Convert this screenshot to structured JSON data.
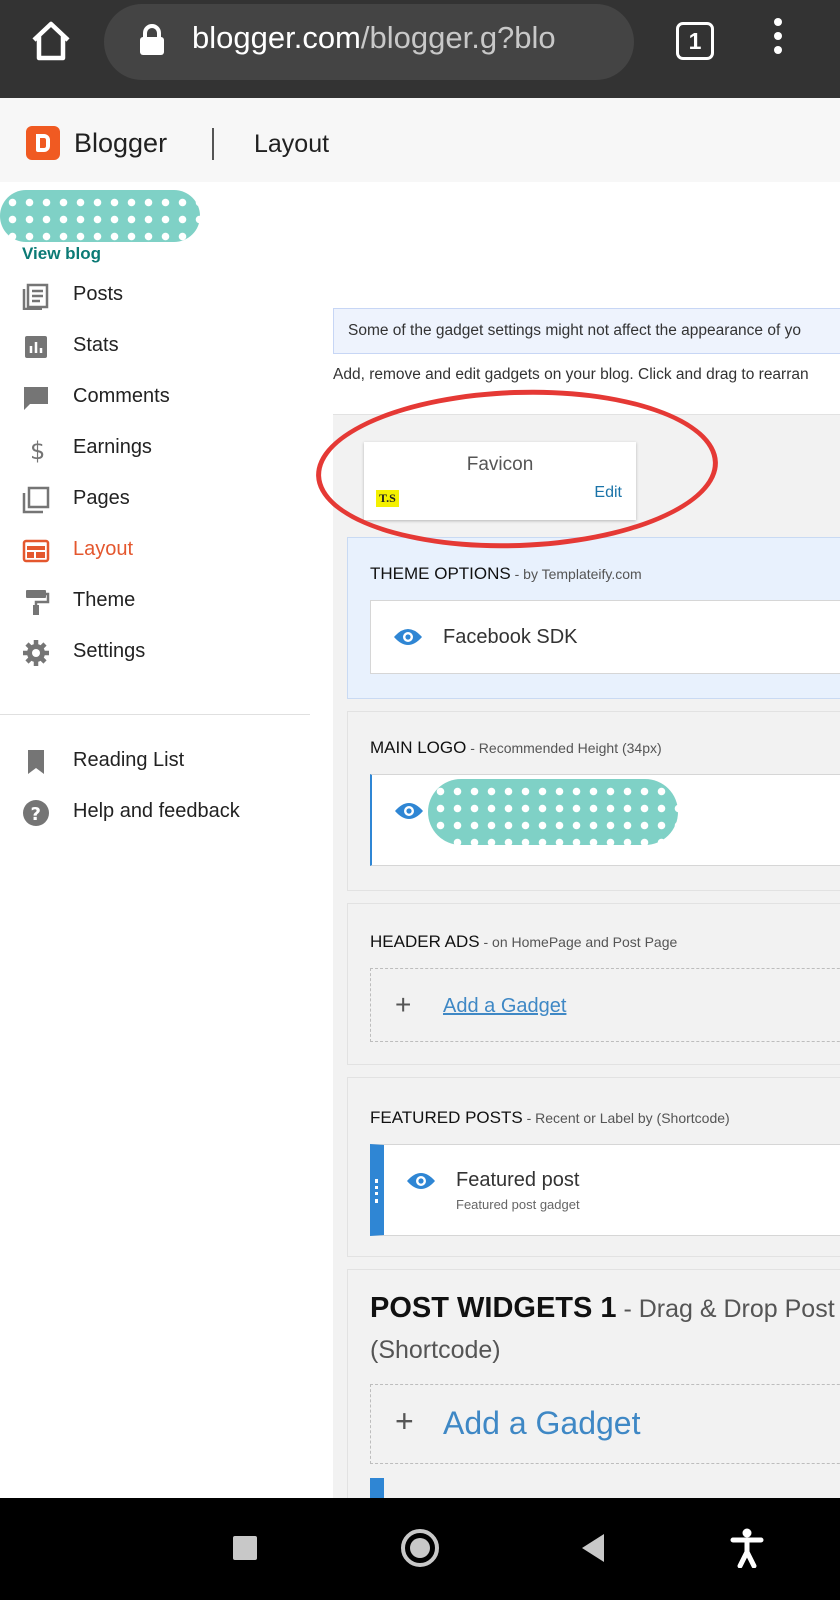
{
  "browser": {
    "url_host": "blogger.com",
    "url_rest": "/blogger.g?blo",
    "tab_count": "1"
  },
  "header": {
    "app_name": "Blogger",
    "page_title": "Layout"
  },
  "sidebar": {
    "view_blog": "View blog",
    "items": [
      {
        "label": "Posts",
        "icon": "posts-icon"
      },
      {
        "label": "Stats",
        "icon": "stats-icon"
      },
      {
        "label": "Comments",
        "icon": "comments-icon"
      },
      {
        "label": "Earnings",
        "icon": "dollar-icon"
      },
      {
        "label": "Pages",
        "icon": "pages-icon"
      },
      {
        "label": "Layout",
        "icon": "layout-icon",
        "active": true
      },
      {
        "label": "Theme",
        "icon": "paint-roller-icon"
      },
      {
        "label": "Settings",
        "icon": "gear-icon"
      }
    ],
    "secondary": [
      {
        "label": "Reading List",
        "icon": "bookmark-icon"
      },
      {
        "label": "Help and feedback",
        "icon": "help-icon"
      }
    ]
  },
  "main": {
    "notice": "Some of the gadget settings might not affect the appearance of yo",
    "help_text": "Add, remove and edit gadgets on your blog. Click and drag to rearran",
    "favicon": {
      "title": "Favicon",
      "badge": "T.S",
      "edit": "Edit"
    },
    "sections": {
      "theme_options": {
        "title": "THEME OPTIONS",
        "subtitle": " - by Templateify.com",
        "gadget": "Facebook SDK"
      },
      "main_logo": {
        "title": "MAIN LOGO",
        "subtitle": " - Recommended Height (34px)"
      },
      "header_ads": {
        "title": "HEADER ADS",
        "subtitle": " - on HomePage and Post Page",
        "add": "Add a Gadget"
      },
      "featured_posts": {
        "title": "FEATURED POSTS",
        "subtitle": " - Recent or Label by (Shortcode)",
        "gadget": "Featured post",
        "gadget_desc": "Featured post gadget"
      },
      "post_widgets": {
        "title": "POST WIDGETS 1",
        "subtitle": " - Drag & Drop Post W",
        "subtitle2": "(Shortcode)",
        "add": "Add a Gadget"
      }
    }
  },
  "colors": {
    "accent_orange": "#f05a22",
    "link_blue": "#3f88c5",
    "annotation_red": "#e53935"
  }
}
